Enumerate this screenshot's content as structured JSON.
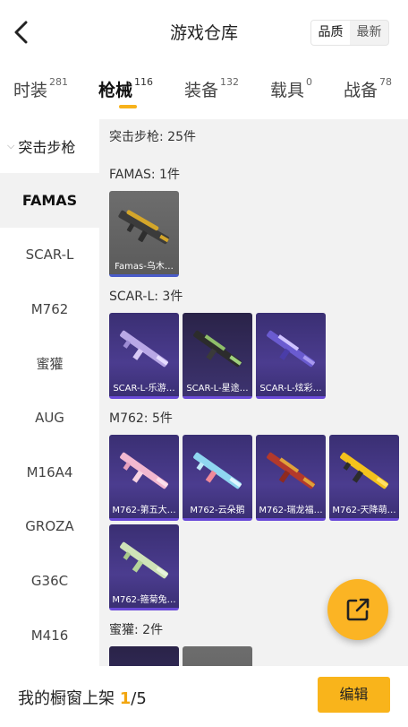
{
  "header": {
    "title": "游戏仓库",
    "sort_options": [
      "品质",
      "最新"
    ],
    "active_sort": 0
  },
  "tabs": [
    {
      "label": "时装",
      "count": "281"
    },
    {
      "label": "枪械",
      "count": "116"
    },
    {
      "label": "装备",
      "count": "132"
    },
    {
      "label": "载具",
      "count": "0"
    },
    {
      "label": "战备",
      "count": "78"
    }
  ],
  "sidebar": {
    "group_label": "突击步枪",
    "items": [
      "FAMAS",
      "SCAR-L",
      "M762",
      "蜜獾",
      "AUG",
      "M16A4",
      "GROZA",
      "G36C",
      "M416"
    ]
  },
  "content": {
    "section_title": "突击步枪: 25件",
    "groups": [
      {
        "title": "FAMAS: 1件",
        "items": [
          "Famas-乌木…"
        ]
      },
      {
        "title": "SCAR-L: 3件",
        "items": [
          "SCAR-L-乐游…",
          "SCAR-L-星途…",
          "SCAR-L-炫彩…"
        ]
      },
      {
        "title": "M762: 5件",
        "items": [
          "M762-第五大…",
          "M762-云朵鹅",
          "M762-瑞龙福…",
          "M762-天降萌…",
          "M762-箍菊兔…"
        ]
      },
      {
        "title": "蜜獾: 2件",
        "items": []
      }
    ]
  },
  "footer": {
    "shelf_label": "我的橱窗上架",
    "shelf_current": "1",
    "shelf_sep": "/",
    "shelf_total": "5",
    "edit_label": "编辑"
  },
  "colors": {
    "accent": "#f9b41b",
    "card_purple": "#3a2f73",
    "content_bg": "#f2f2f2"
  },
  "icons": {
    "back": "chevron-left-icon",
    "fab": "share-export-icon",
    "group": "chevron-down-icon"
  }
}
